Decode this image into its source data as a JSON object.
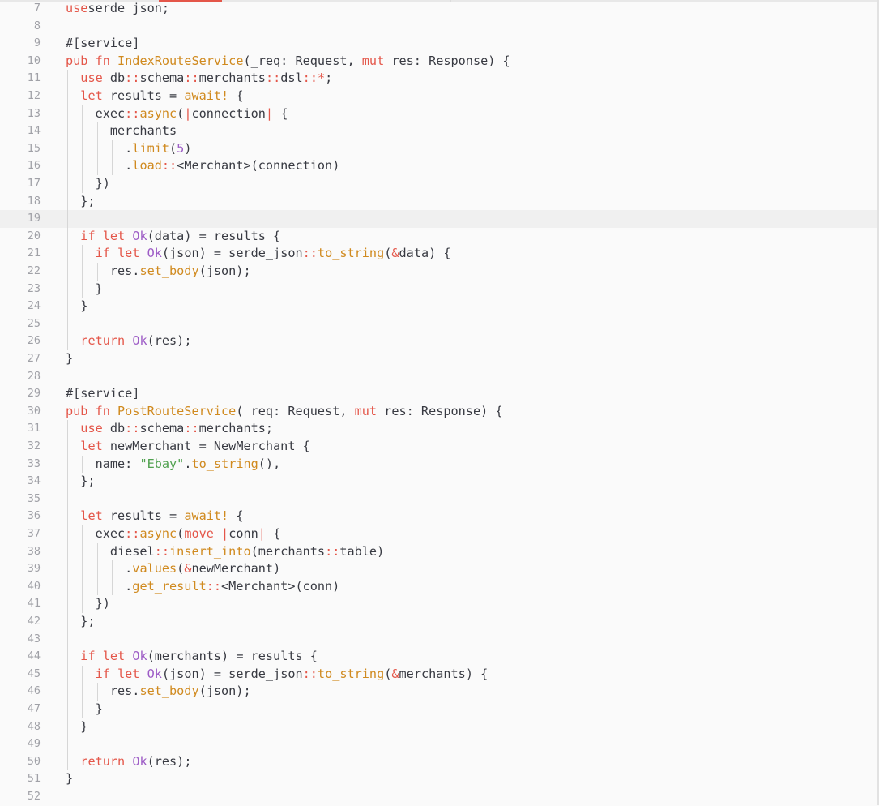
{
  "editor": {
    "language": "rust",
    "current_line": 19,
    "colors": {
      "background": "#fafafa",
      "current_line": "#f0f0f0",
      "gutter_text": "#a0a1a7",
      "keyword": "#e45649",
      "function": "#d08a1f",
      "type": "#9d5cc6",
      "string": "#50a14f",
      "text": "#383a42"
    },
    "lines": [
      {
        "num": "7",
        "tokens": [
          [
            "kw",
            "use"
          ],
          [
            "",
            "serde_json;"
          ]
        ]
      },
      {
        "num": "8",
        "tokens": []
      },
      {
        "num": "9",
        "tokens": [
          [
            "",
            "#[service]"
          ]
        ]
      },
      {
        "num": "10",
        "tokens": [
          [
            "kw",
            "pub fn "
          ],
          [
            "name",
            "IndexRouteService"
          ],
          [
            "",
            "(_req: Request, "
          ],
          [
            "kw",
            "mut "
          ],
          [
            "",
            "res: Response) {"
          ]
        ]
      },
      {
        "num": "11",
        "tokens": [
          [
            "",
            "  "
          ],
          [
            "kw",
            "use "
          ],
          [
            "",
            "db"
          ],
          [
            "op",
            "::"
          ],
          [
            "",
            "schema"
          ],
          [
            "op",
            "::"
          ],
          [
            "",
            "merchants"
          ],
          [
            "op",
            "::"
          ],
          [
            "",
            "dsl"
          ],
          [
            "op",
            "::"
          ],
          [
            "op",
            "*"
          ],
          [
            "",
            ";"
          ]
        ]
      },
      {
        "num": "12",
        "tokens": [
          [
            "",
            "  "
          ],
          [
            "kw",
            "let "
          ],
          [
            "",
            "results = "
          ],
          [
            "mac",
            "await!"
          ],
          [
            "",
            " {"
          ]
        ]
      },
      {
        "num": "13",
        "tokens": [
          [
            "",
            "    exec"
          ],
          [
            "op",
            "::"
          ],
          [
            "fn",
            "async"
          ],
          [
            "",
            "("
          ],
          [
            "op",
            "|"
          ],
          [
            "",
            "connection"
          ],
          [
            "op",
            "|"
          ],
          [
            "",
            " {"
          ]
        ]
      },
      {
        "num": "14",
        "tokens": [
          [
            "",
            "      merchants"
          ]
        ]
      },
      {
        "num": "15",
        "tokens": [
          [
            "",
            "        ."
          ],
          [
            "fn",
            "limit"
          ],
          [
            "",
            "("
          ],
          [
            "num",
            "5"
          ],
          [
            "",
            ")"
          ]
        ]
      },
      {
        "num": "16",
        "tokens": [
          [
            "",
            "        ."
          ],
          [
            "fn",
            "load"
          ],
          [
            "op",
            "::"
          ],
          [
            "",
            "<Merchant>(connection)"
          ]
        ]
      },
      {
        "num": "17",
        "tokens": [
          [
            "",
            "    })"
          ]
        ]
      },
      {
        "num": "18",
        "tokens": [
          [
            "",
            "  };"
          ]
        ]
      },
      {
        "num": "19",
        "tokens": []
      },
      {
        "num": "20",
        "tokens": [
          [
            "",
            "  "
          ],
          [
            "kw",
            "if let "
          ],
          [
            "ty",
            "Ok"
          ],
          [
            "",
            "(data) = results {"
          ]
        ]
      },
      {
        "num": "21",
        "tokens": [
          [
            "",
            "    "
          ],
          [
            "kw",
            "if let "
          ],
          [
            "ty",
            "Ok"
          ],
          [
            "",
            "(json) = serde_json"
          ],
          [
            "op",
            "::"
          ],
          [
            "fn",
            "to_string"
          ],
          [
            "",
            "("
          ],
          [
            "op",
            "&"
          ],
          [
            "",
            "data) {"
          ]
        ]
      },
      {
        "num": "22",
        "tokens": [
          [
            "",
            "      res."
          ],
          [
            "fn",
            "set_body"
          ],
          [
            "",
            "(json);"
          ]
        ]
      },
      {
        "num": "23",
        "tokens": [
          [
            "",
            "    }"
          ]
        ]
      },
      {
        "num": "24",
        "tokens": [
          [
            "",
            "  }"
          ]
        ]
      },
      {
        "num": "25",
        "tokens": []
      },
      {
        "num": "26",
        "tokens": [
          [
            "",
            "  "
          ],
          [
            "kw",
            "return "
          ],
          [
            "ty",
            "Ok"
          ],
          [
            "",
            "(res);"
          ]
        ]
      },
      {
        "num": "27",
        "tokens": [
          [
            "",
            "}"
          ]
        ]
      },
      {
        "num": "28",
        "tokens": []
      },
      {
        "num": "29",
        "tokens": [
          [
            "",
            "#[service]"
          ]
        ]
      },
      {
        "num": "30",
        "tokens": [
          [
            "kw",
            "pub fn "
          ],
          [
            "name",
            "PostRouteService"
          ],
          [
            "",
            "(_req: Request, "
          ],
          [
            "kw",
            "mut "
          ],
          [
            "",
            "res: Response) {"
          ]
        ]
      },
      {
        "num": "31",
        "tokens": [
          [
            "",
            "  "
          ],
          [
            "kw",
            "use "
          ],
          [
            "",
            "db"
          ],
          [
            "op",
            "::"
          ],
          [
            "",
            "schema"
          ],
          [
            "op",
            "::"
          ],
          [
            "",
            "merchants;"
          ]
        ]
      },
      {
        "num": "32",
        "tokens": [
          [
            "",
            "  "
          ],
          [
            "kw",
            "let "
          ],
          [
            "",
            "newMerchant = NewMerchant {"
          ]
        ]
      },
      {
        "num": "33",
        "tokens": [
          [
            "",
            "    name: "
          ],
          [
            "str",
            "\"Ebay\""
          ],
          [
            "",
            "."
          ],
          [
            "fn",
            "to_string"
          ],
          [
            "",
            "(),"
          ]
        ]
      },
      {
        "num": "34",
        "tokens": [
          [
            "",
            "  };"
          ]
        ]
      },
      {
        "num": "35",
        "tokens": []
      },
      {
        "num": "36",
        "tokens": [
          [
            "",
            "  "
          ],
          [
            "kw",
            "let "
          ],
          [
            "",
            "results = "
          ],
          [
            "mac",
            "await!"
          ],
          [
            "",
            " {"
          ]
        ]
      },
      {
        "num": "37",
        "tokens": [
          [
            "",
            "    exec"
          ],
          [
            "op",
            "::"
          ],
          [
            "fn",
            "async"
          ],
          [
            "",
            "("
          ],
          [
            "kw",
            "move "
          ],
          [
            "op",
            "|"
          ],
          [
            "",
            "conn"
          ],
          [
            "op",
            "|"
          ],
          [
            "",
            " {"
          ]
        ]
      },
      {
        "num": "38",
        "tokens": [
          [
            "",
            "      diesel"
          ],
          [
            "op",
            "::"
          ],
          [
            "fn",
            "insert_into"
          ],
          [
            "",
            "(merchants"
          ],
          [
            "op",
            "::"
          ],
          [
            "",
            "table)"
          ]
        ]
      },
      {
        "num": "39",
        "tokens": [
          [
            "",
            "        ."
          ],
          [
            "fn",
            "values"
          ],
          [
            "",
            "("
          ],
          [
            "op",
            "&"
          ],
          [
            "",
            "newMerchant)"
          ]
        ]
      },
      {
        "num": "40",
        "tokens": [
          [
            "",
            "        ."
          ],
          [
            "fn",
            "get_result"
          ],
          [
            "op",
            "::"
          ],
          [
            "",
            "<Merchant>(conn)"
          ]
        ]
      },
      {
        "num": "41",
        "tokens": [
          [
            "",
            "    })"
          ]
        ]
      },
      {
        "num": "42",
        "tokens": [
          [
            "",
            "  };"
          ]
        ]
      },
      {
        "num": "43",
        "tokens": []
      },
      {
        "num": "44",
        "tokens": [
          [
            "",
            "  "
          ],
          [
            "kw",
            "if let "
          ],
          [
            "ty",
            "Ok"
          ],
          [
            "",
            "(merchants) = results {"
          ]
        ]
      },
      {
        "num": "45",
        "tokens": [
          [
            "",
            "    "
          ],
          [
            "kw",
            "if let "
          ],
          [
            "ty",
            "Ok"
          ],
          [
            "",
            "(json) = serde_json"
          ],
          [
            "op",
            "::"
          ],
          [
            "fn",
            "to_string"
          ],
          [
            "",
            "("
          ],
          [
            "op",
            "&"
          ],
          [
            "",
            "merchants) {"
          ]
        ]
      },
      {
        "num": "46",
        "tokens": [
          [
            "",
            "      res."
          ],
          [
            "fn",
            "set_body"
          ],
          [
            "",
            "(json);"
          ]
        ]
      },
      {
        "num": "47",
        "tokens": [
          [
            "",
            "    }"
          ]
        ]
      },
      {
        "num": "48",
        "tokens": [
          [
            "",
            "  }"
          ]
        ]
      },
      {
        "num": "49",
        "tokens": []
      },
      {
        "num": "50",
        "tokens": [
          [
            "",
            "  "
          ],
          [
            "kw",
            "return "
          ],
          [
            "ty",
            "Ok"
          ],
          [
            "",
            "(res);"
          ]
        ]
      },
      {
        "num": "51",
        "tokens": [
          [
            "",
            "}"
          ]
        ]
      },
      {
        "num": "52",
        "tokens": []
      }
    ]
  }
}
